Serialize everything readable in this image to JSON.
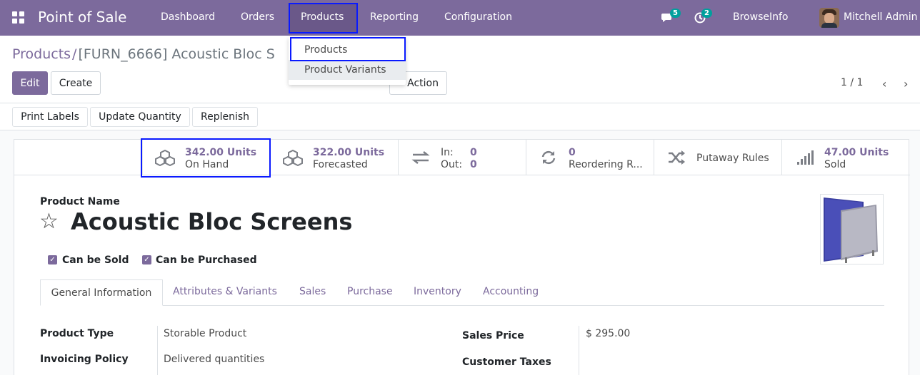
{
  "navbar": {
    "brand": "Point of Sale",
    "menu": [
      "Dashboard",
      "Orders",
      "Products",
      "Reporting",
      "Configuration"
    ],
    "chat_badge": "5",
    "activity_badge": "2",
    "company": "BrowseInfo",
    "user": "Mitchell Admin"
  },
  "breadcrumb": {
    "parent": "Products",
    "separator": "/",
    "current": "[FURN_6666] Acoustic Bloc S"
  },
  "actions": {
    "edit": "Edit",
    "create": "Create",
    "action": "Action"
  },
  "pager": {
    "value": "1 / 1",
    "prev": "‹",
    "next": "›"
  },
  "dropdown": {
    "items": [
      "Products",
      "Product Variants"
    ]
  },
  "status_buttons": [
    "Print Labels",
    "Update Quantity",
    "Replenish"
  ],
  "smart_buttons": [
    {
      "value": "342.00 Units",
      "label": "On Hand",
      "icon": "cubes-icon"
    },
    {
      "value": "322.00 Units",
      "label": "Forecasted",
      "icon": "cubes-icon"
    },
    {
      "in_label": "In:",
      "in_value": "0",
      "out_label": "Out:",
      "out_value": "0",
      "icon": "exchange-icon"
    },
    {
      "value": "0",
      "label": "Reordering R...",
      "icon": "refresh-icon"
    },
    {
      "value": "Putaway Rules",
      "icon": "random-icon"
    },
    {
      "value": "47.00 Units",
      "label": "Sold",
      "icon": "signal-icon"
    }
  ],
  "form": {
    "name_label": "Product Name",
    "name": "Acoustic Bloc Screens",
    "can_be_sold": "Can be Sold",
    "can_be_purchased": "Can be Purchased"
  },
  "tabs": [
    "General Information",
    "Attributes & Variants",
    "Sales",
    "Purchase",
    "Inventory",
    "Accounting"
  ],
  "fields": {
    "product_type_label": "Product Type",
    "product_type": "Storable Product",
    "invoicing_policy_label": "Invoicing Policy",
    "invoicing_policy": "Delivered quantities",
    "sales_price_label": "Sales Price",
    "sales_price": "$ 295.00",
    "customer_taxes_label": "Customer Taxes"
  }
}
